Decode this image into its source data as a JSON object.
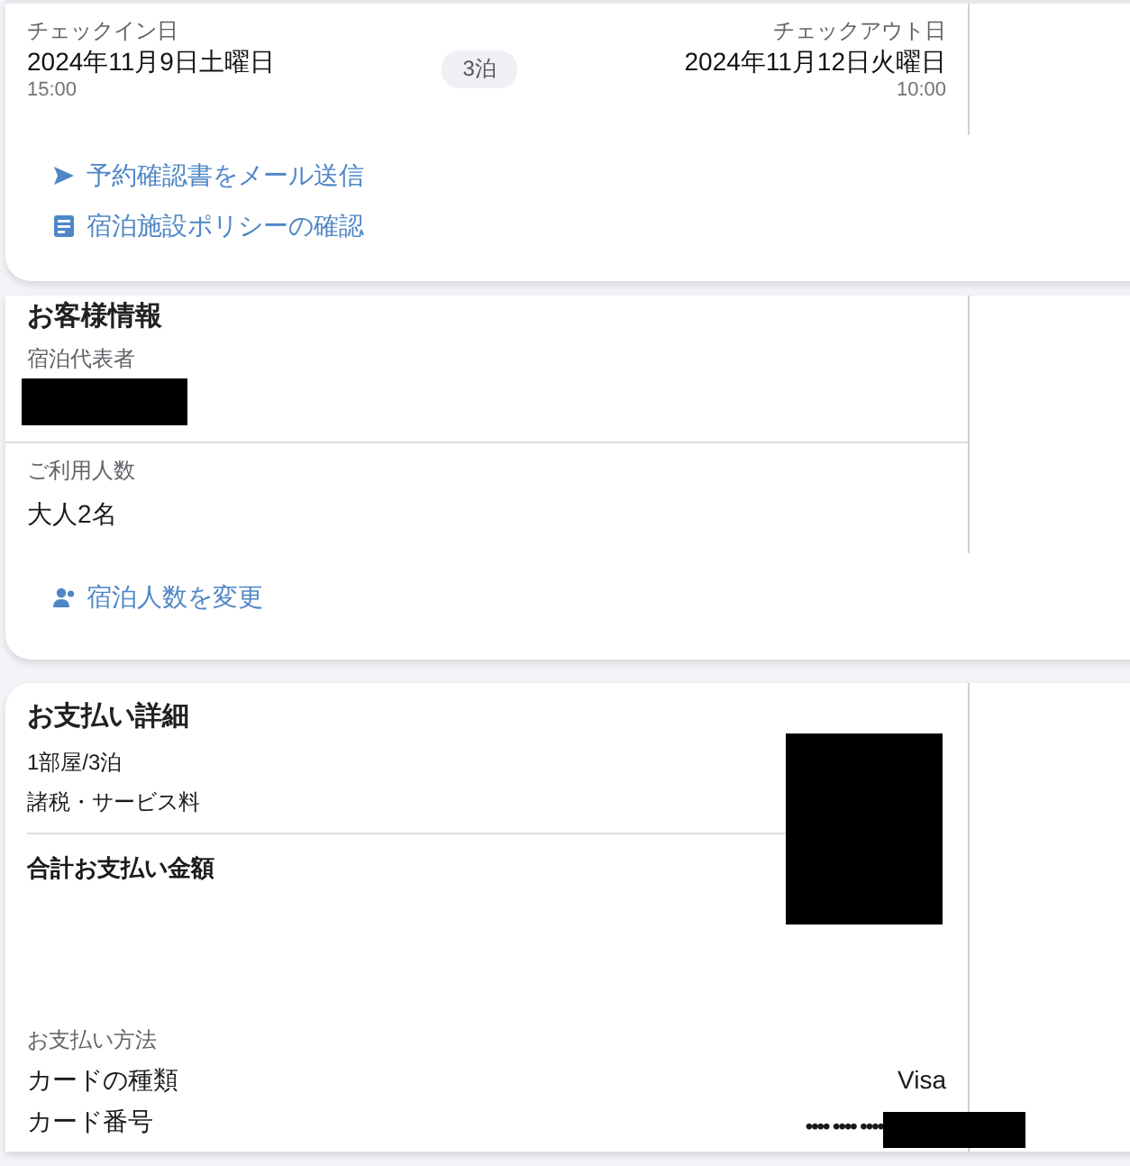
{
  "stay": {
    "checkin": {
      "label": "チェックイン日",
      "date": "2024年11月9日土曜日",
      "time": "15:00"
    },
    "nights": "3泊",
    "checkout": {
      "label": "チェックアウト日",
      "date": "2024年11月12日火曜日",
      "time": "10:00"
    },
    "links": [
      {
        "kind": "send",
        "label": "予約確認書をメール送信"
      },
      {
        "kind": "document",
        "label": "宿泊施設ポリシーの確認"
      }
    ]
  },
  "guest_info": {
    "title": "お客様情報",
    "representative_label": "宿泊代表者",
    "guests_label": "ご利用人数",
    "guests_value": "大人2名",
    "link": {
      "kind": "people",
      "label": "宿泊人数を変更"
    }
  },
  "payment": {
    "title": "お支払い詳細",
    "lines": [
      "1部屋/3泊",
      "諸税・サービス料"
    ],
    "total_label": "合計お支払い金額",
    "method_label": "お支払い方法",
    "card_type_label": "カードの種類",
    "card_type": "Visa",
    "card_number_label": "カード番号",
    "card_number": "•••• •••• ••••"
  }
}
